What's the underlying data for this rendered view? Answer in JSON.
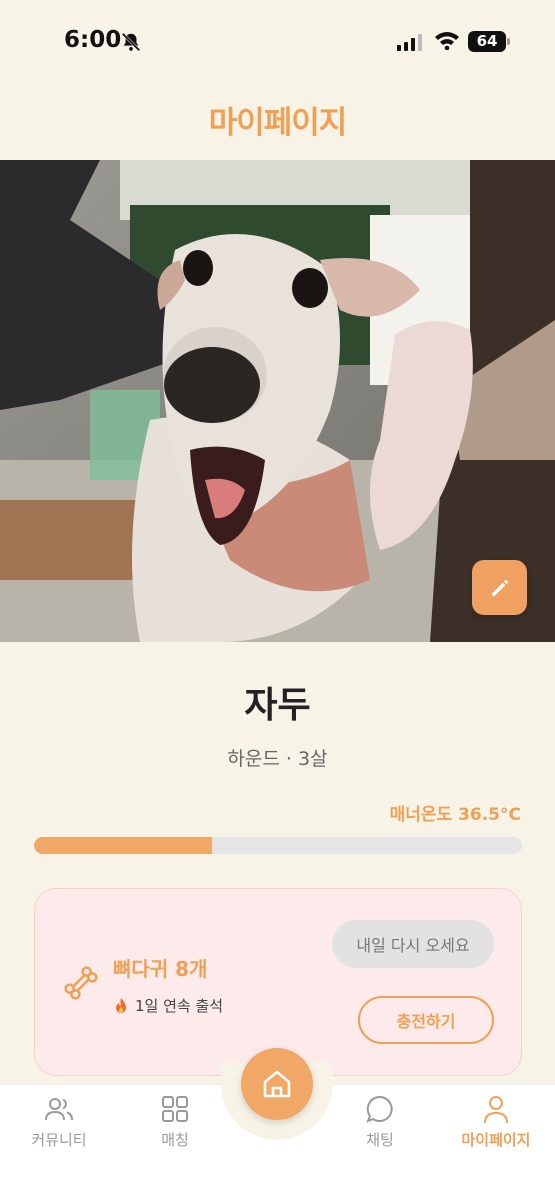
{
  "status_bar": {
    "time": "6:00",
    "battery": "64"
  },
  "header": {
    "title": "마이페이지"
  },
  "profile": {
    "name": "자두",
    "info": "하운드 · 3살",
    "manner_label": "매너온도 36.5°C",
    "manner_progress_fraction": 0.365
  },
  "rewards": {
    "bones": "뼈다귀 8개",
    "streak": "1일 연속 출석",
    "come_back_label": "내일 다시 오세요",
    "charge_label": "충전하기"
  },
  "nav": {
    "community": "커뮤니티",
    "matching": "매칭",
    "chat": "채팅",
    "mypage": "마이페이지"
  },
  "colors": {
    "accent": "#f0a055",
    "background": "#f7f3e6",
    "card": "#fdeaea"
  }
}
